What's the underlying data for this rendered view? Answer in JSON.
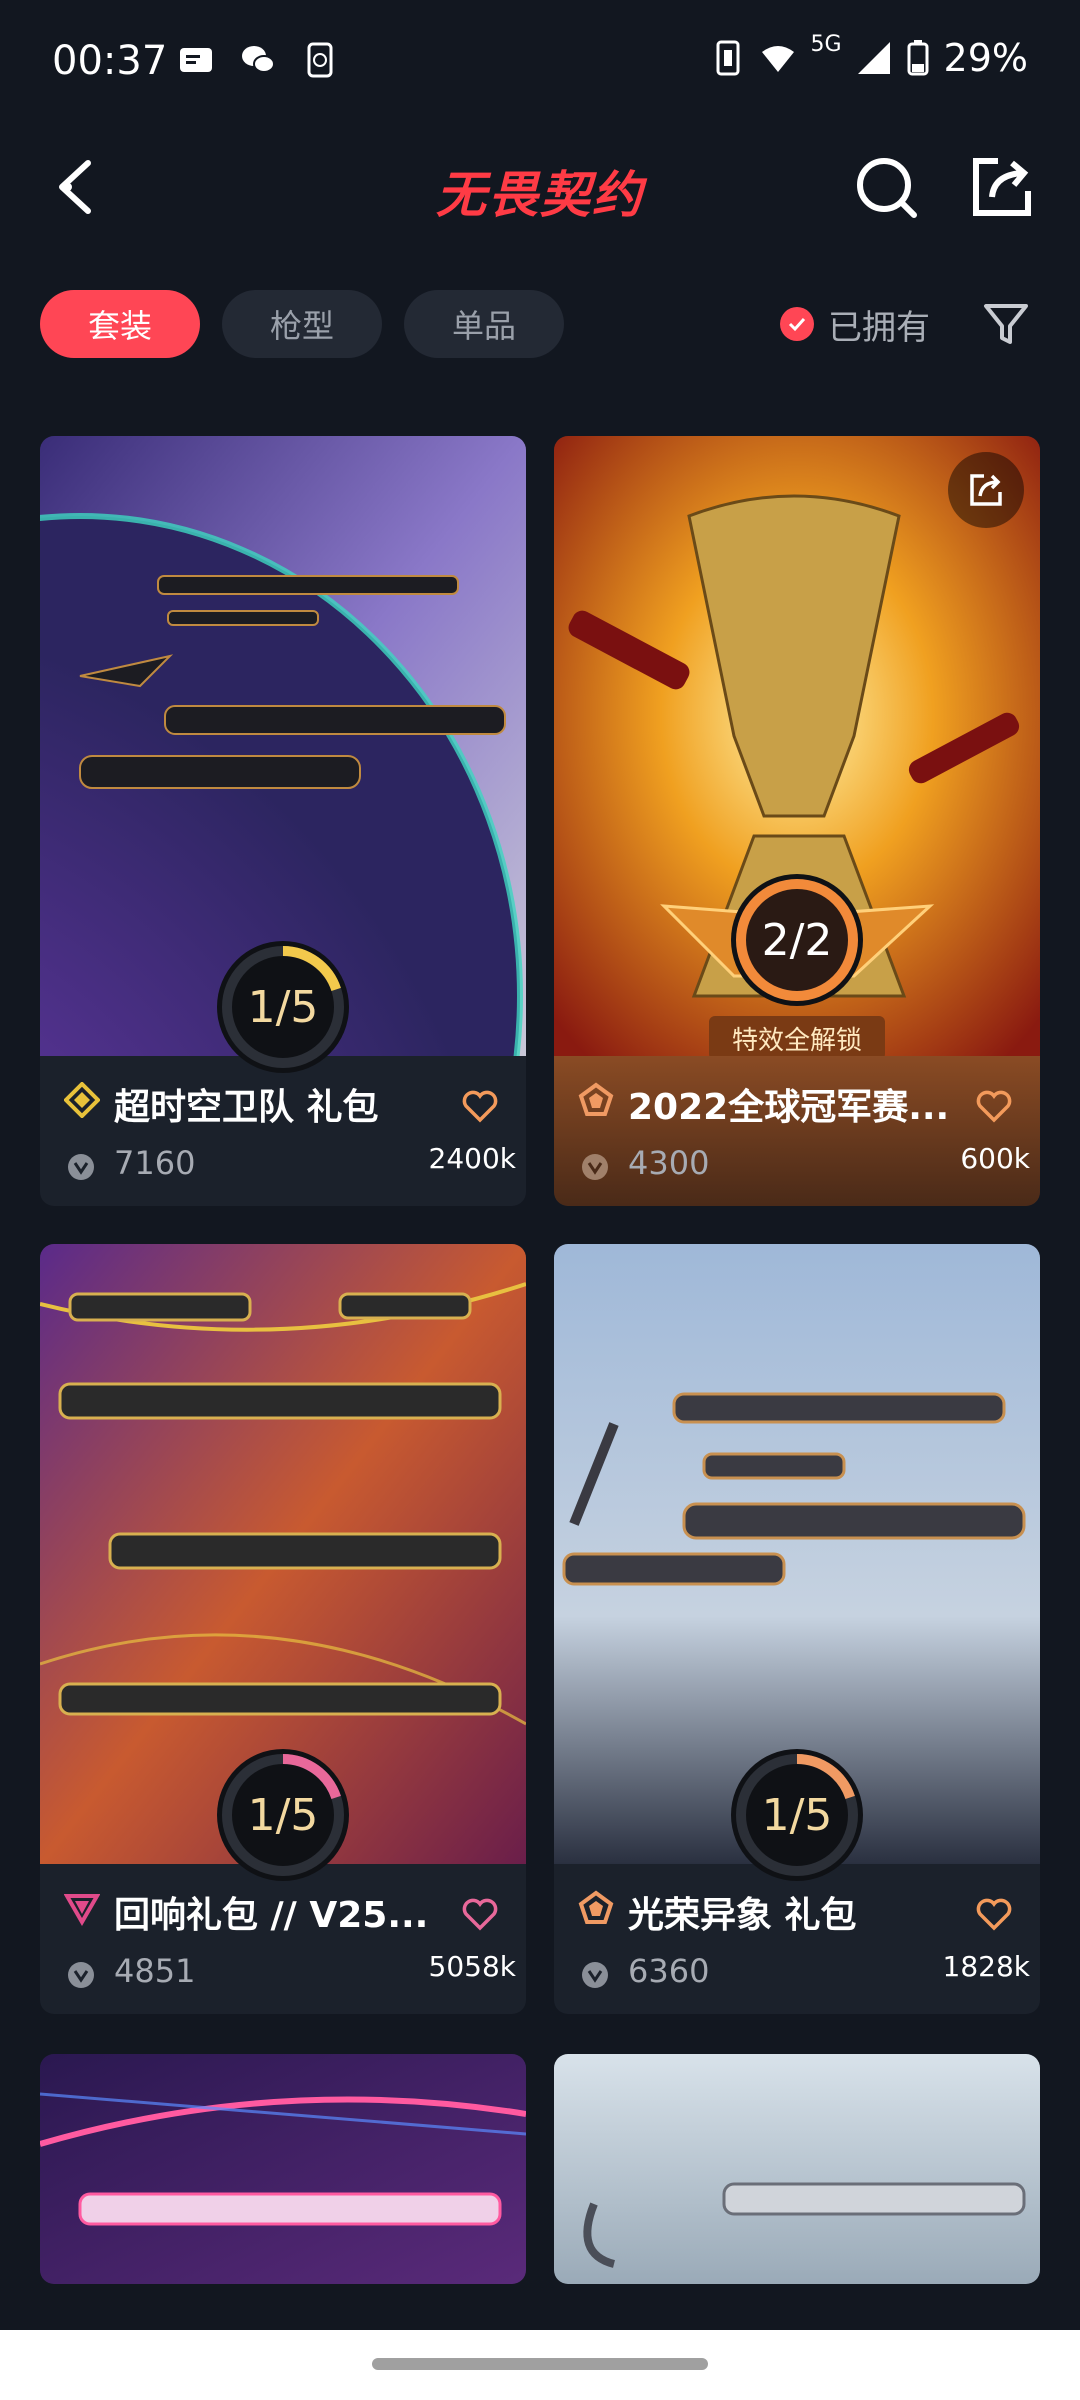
{
  "status_bar": {
    "time": "00:37",
    "network": "5G",
    "battery": "29%",
    "icons": [
      "message-icon",
      "wechat-icon",
      "phone-sync-icon",
      "nfc-icon",
      "wifi-icon",
      "signal-icon",
      "battery-icon"
    ]
  },
  "header": {
    "title": "无畏契约",
    "title_color": "#ff3b45"
  },
  "filters": {
    "chips": [
      {
        "label": "套装",
        "active": true
      },
      {
        "label": "枪型",
        "active": false
      },
      {
        "label": "单品",
        "active": false
      }
    ],
    "owned_label": "已拥有"
  },
  "cards": [
    {
      "name": "超时空卫队 礼包",
      "price": "7160",
      "likes": "2400k",
      "progress": "1/5",
      "progress_value": 0.2,
      "tier_color": "#e8c23a",
      "tier_icon": "diamond-icon"
    },
    {
      "name": "2022全球冠军赛...",
      "price": "4300",
      "likes": "600k",
      "progress": "2/2",
      "progress_value": 1.0,
      "unlock_text": "特效全解锁",
      "tier_color": "#f09a63",
      "tier_icon": "pentagon-icon"
    },
    {
      "name": "回响礼包 // V25...",
      "price": "4851",
      "likes": "5058k",
      "progress": "1/5",
      "progress_value": 0.2,
      "tier_color": "#e04a8a",
      "tier_icon": "triangle-icon"
    },
    {
      "name": "光荣异象 礼包",
      "price": "6360",
      "likes": "1828k",
      "progress": "1/5",
      "progress_value": 0.2,
      "tier_color": "#f09a63",
      "tier_icon": "pentagon-icon"
    }
  ],
  "colors": {
    "accent": "#ff4655",
    "background": "#121720",
    "heart": "#f39a5b"
  }
}
